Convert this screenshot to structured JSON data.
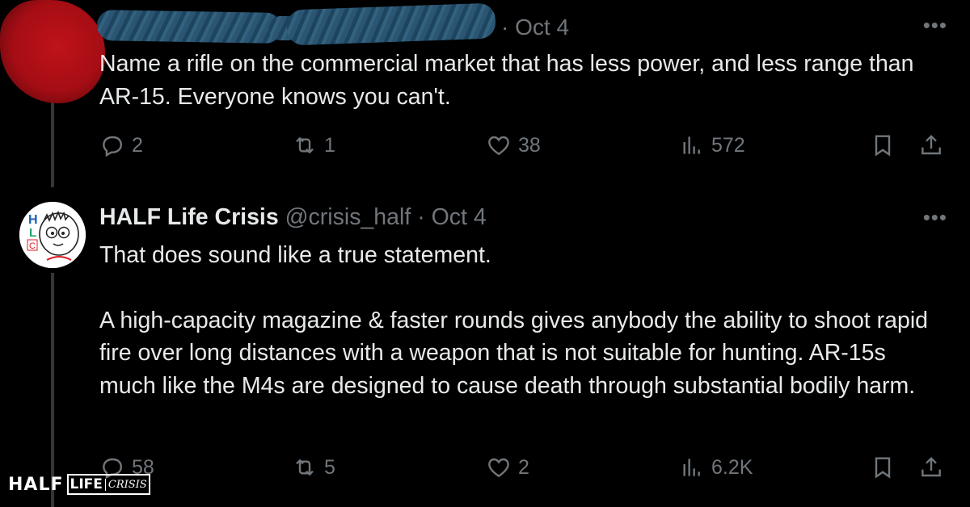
{
  "tweet1": {
    "date": "· Oct 4",
    "more": "•••",
    "text": "Name a rifle on the commercial market that has less power, and less range than AR-15. Everyone knows you can't.",
    "stats": {
      "replies": "2",
      "reposts": "1",
      "likes": "38",
      "views": "572"
    }
  },
  "tweet2": {
    "author_name": "HALF Life Crisis",
    "handle": "@crisis_half",
    "separator": "·",
    "date": "Oct 4",
    "more": "•••",
    "paragraph1": "That does sound like a true statement.",
    "paragraph2": "A high-capacity magazine & faster rounds gives anybody the ability to shoot rapid fire over long distances with a weapon that is not suitable for hunting. AR-15s much like the M4s are designed to cause death through substantial bodily harm.",
    "stats": {
      "replies": "58",
      "reposts": "5",
      "likes": "2",
      "views": "6.2K"
    },
    "avatar_letters": [
      "H",
      "L",
      "C"
    ],
    "avatar_letter_colors": [
      "#1a5fb4",
      "#26a269",
      "#e01b24"
    ]
  },
  "watermark": {
    "half": "HALF",
    "life": "LIFE",
    "crisis": "CRISIS"
  },
  "colors": {
    "text": "#e7e9ea",
    "muted": "#71767b",
    "background": "#000000",
    "redaction_red": "#b3121a",
    "redaction_blue": "#2b5573"
  },
  "icons": [
    "reply-icon",
    "repost-icon",
    "like-icon",
    "views-icon",
    "bookmark-icon",
    "share-icon",
    "more-icon"
  ]
}
